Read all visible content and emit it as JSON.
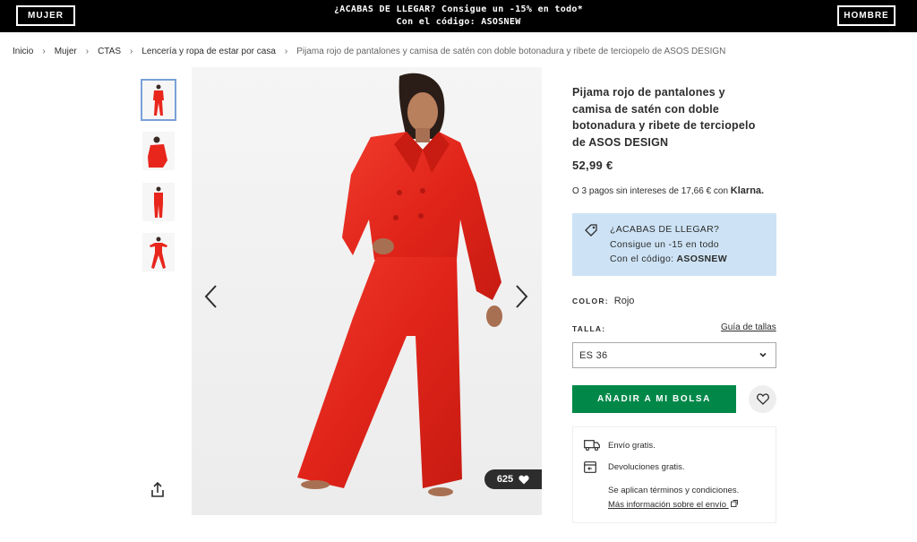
{
  "topbar": {
    "women_label": "MUJER",
    "men_label": "HOMBRE",
    "promo_line1": "¿ACABAS DE LLEGAR? Consigue un -15% en todo*",
    "promo_line2": "Con el código: ASOSNEW",
    "background": "#000000"
  },
  "breadcrumb": [
    {
      "label": "Inicio"
    },
    {
      "label": "Mujer"
    },
    {
      "label": "CTAS"
    },
    {
      "label": "Lencería y ropa de estar por casa"
    },
    {
      "label": "Pijama rojo de pantalones y camisa de satén con doble botonadura y ribete de terciopelo de ASOS DESIGN"
    }
  ],
  "gallery": {
    "thumbnail_count": 4,
    "active_index": 0,
    "likes_count": "625",
    "garment_color": "#e8261c",
    "prev_icon": "chevron-left-icon",
    "next_icon": "chevron-right-icon"
  },
  "product": {
    "title": "Pijama rojo de pantalones y camisa de satén con doble botonadura y ribete de terciopelo de ASOS DESIGN",
    "price": "52,99 €",
    "klarna_text": "O 3 pagos sin intereses de 17,66 € con",
    "klarna_brand": "Klarna."
  },
  "promo_box": {
    "line1": "¿ACABAS DE LLEGAR?",
    "line2": "Consigue un -15 en todo",
    "line3_prefix": "Con el código:",
    "code": "ASOSNEW",
    "background": "#cde3f5"
  },
  "options": {
    "color_label": "COLOR:",
    "color_value": "Rojo",
    "size_label": "TALLA:",
    "size_guide": "Guía de tallas",
    "size_value": "ES 36"
  },
  "actions": {
    "add_to_bag": "AÑADIR A MI BOLSA",
    "accent": "#018849"
  },
  "delivery": {
    "shipping": "Envío gratis.",
    "returns": "Devoluciones gratis.",
    "terms": "Se aplican términos y condiciones.",
    "more_info": "Más información sobre el envío"
  }
}
